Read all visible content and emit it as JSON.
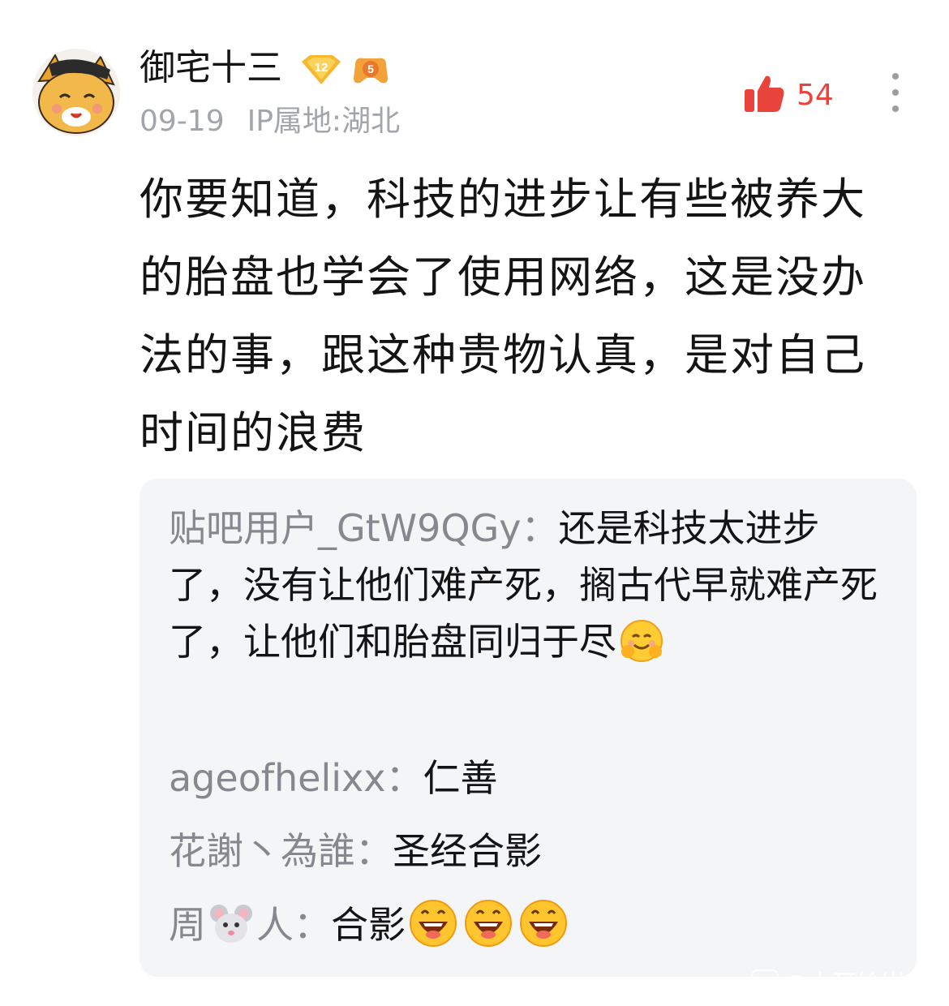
{
  "comment": {
    "username": "御宅十三",
    "level_badge": "12",
    "fan_badge": "5",
    "date": "09-19",
    "ip_location": "IP属地:湖北",
    "like_count": "54",
    "like_icon": "thumbs-up-icon",
    "more_icon": "more-vertical-icon",
    "text": "你要知道，科技的进步让有些被养大的胎盘也学会了使用网络，这是没办法的事，跟这种贵物认真，是对自己时间的浪费"
  },
  "replies": [
    {
      "author": "贴吧用户_GtW9QGy",
      "separator": "：",
      "text": "还是科技太进步了，没有让他们难产死，搁古代早就难产死了，让他们和胎盘同归于尽",
      "emoji": "hugging-face-emoji"
    },
    {
      "author": "ageofhelixx",
      "separator": "：",
      "text": "仁善"
    },
    {
      "author": "花謝丶為誰",
      "separator": "：",
      "text": "圣经合影"
    },
    {
      "author_prefix": "周",
      "author_suffix": "人",
      "author_emoji": "mouse-face-emoji",
      "separator": "：",
      "text": "合影",
      "emojis": [
        "grinning-emoji",
        "grinning-emoji",
        "grinning-emoji"
      ]
    }
  ],
  "colors": {
    "accent_like": "#e8443b",
    "meta_gray": "#a2a5ab",
    "reply_author": "#85888f",
    "reply_bg": "#f4f5f7",
    "text": "#141414"
  },
  "watermark": {
    "text": "@大耳绘岁"
  }
}
